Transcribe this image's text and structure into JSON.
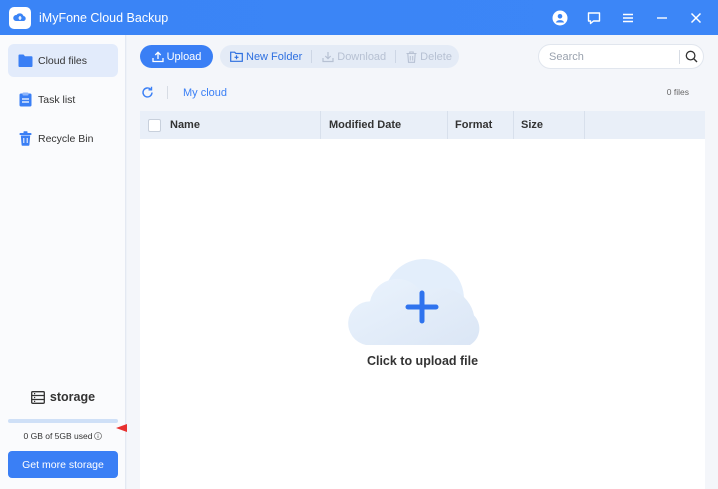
{
  "app": {
    "title": "iMyFone Cloud Backup"
  },
  "titlebar": {
    "icons": [
      "user-icon",
      "feedback-icon",
      "menu-icon",
      "minimize-icon",
      "close-icon"
    ]
  },
  "sidebar": {
    "items": [
      {
        "label": "Cloud files",
        "icon": "folder-icon",
        "active": true
      },
      {
        "label": "Task list",
        "icon": "clipboard-icon",
        "active": false
      },
      {
        "label": "Recycle Bin",
        "icon": "trash-icon",
        "active": false
      }
    ],
    "storage": {
      "title": "storage",
      "used_text": "0 GB of 5GB used",
      "used_fraction": 0.0,
      "button_label": "Get more storage"
    }
  },
  "toolbar": {
    "upload_label": "Upload",
    "new_folder_label": "New Folder",
    "download_label": "Download",
    "delete_label": "Delete"
  },
  "search": {
    "placeholder": "Search"
  },
  "path": {
    "label": "My cloud",
    "file_count": "0 files"
  },
  "table": {
    "columns": [
      "Name",
      "Modified Date",
      "Format",
      "Size"
    ]
  },
  "empty_state": {
    "text": "Click to upload file"
  },
  "colors": {
    "accent": "#3a7ff5",
    "titlebar": "#3a84f6",
    "annotation_arrow": "#e8312f"
  }
}
